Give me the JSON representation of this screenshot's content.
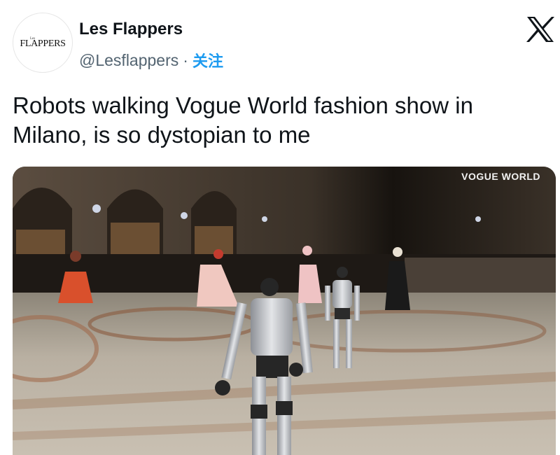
{
  "author": {
    "avatar_small": "Les",
    "avatar_text": "FLAPPERS",
    "display_name": "Les Flappers",
    "handle": "@Lesflappers",
    "separator": "·",
    "follow_label": "关注"
  },
  "platform": {
    "logo": "x-logo-icon"
  },
  "tweet": {
    "text_line1": "Robots walking Vogue World fashion show in",
    "text_line2": "Milano, is so dystopian to me"
  },
  "media": {
    "watermark": "VOGUE WORLD",
    "description_icon": "video-frame"
  }
}
